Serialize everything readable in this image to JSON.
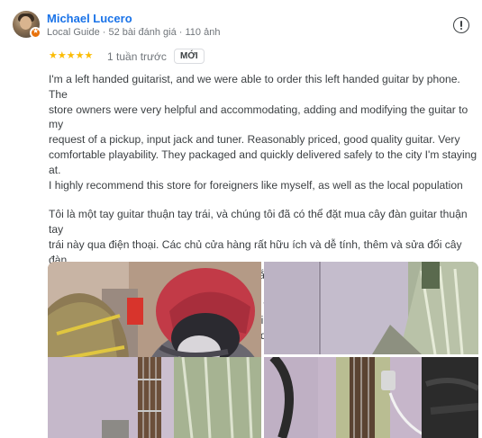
{
  "review": {
    "author_name": "Michael Lucero",
    "author_meta": "Local Guide · 52 bài đánh giá · 110 ảnh",
    "avatar_icon": "user-avatar",
    "local_guide_badge_icon": "local-guide-star-icon",
    "more_icon": "report-icon",
    "rating": 5,
    "stars_text": "★★★★★",
    "date": "1 tuần trước",
    "new_badge": "MỚI",
    "text_en": "I'm a left handed guitarist, and we were able to order this left handed guitar by phone. The\nstore owners were very helpful and accommodating, adding and modifying the guitar to my\nrequest of a pickup, input jack and tuner. Reasonably priced, good quality guitar. Very\ncomfortable playability. They packaged and quickly delivered safely to the city I'm staying at.\nI highly recommend this store for foreigners like myself, as well as the local population",
    "text_vi": "Tôi là một tay guitar thuận tay trái, và chúng tôi đã có thể đặt mua cây đàn guitar thuận tay\ntrái này qua điện thoại. Các chủ cửa hàng rất hữu ích và dễ tính, thêm và sửa đổi cây đàn\nguitar theo yêu cầu của tôi về bộ thu, giắc cắm đầu vào và bộ chỉnh dây. Giá cả phải chăng,\nđàn guitar chất lượng tốt. Khả năng chơi rất thoải mái. Họ đóng gói và giao hàng nhanh\nchóng an toàn đến thành phố tôi đang ở. Tôi thực sự giới thiệu cửa hàng này cho những\nngười nước ngoài như tôi, cũng như người dân địa phương"
  },
  "colors": {
    "author_link": "#1a73e8",
    "star": "#fbbc04",
    "badge": "#e8710a",
    "meta_text": "#70757a",
    "body_text": "#3c4043"
  }
}
